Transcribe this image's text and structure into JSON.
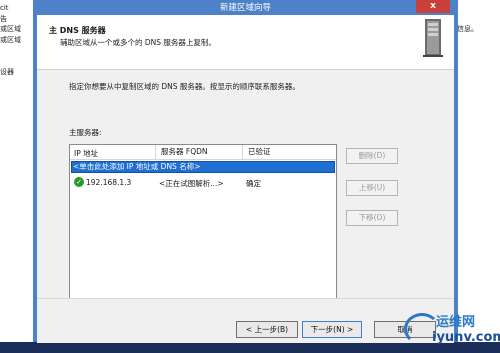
{
  "background": {
    "left_items": [
      "cit",
      "告",
      "或区域",
      "或区域",
      "设器"
    ],
    "right_text": "信息。"
  },
  "dialog": {
    "title": "新建区域向导",
    "close_label": "x",
    "header": {
      "title": "主 DNS 服务器",
      "subtitle": "辅助区域从一个或多个的 DNS 服务器上复制。"
    },
    "instruction": "指定你想要从中复制区域的 DNS 服务器。按显示的顺序联系服务器。",
    "table_label": "主服务器:",
    "columns": [
      "IP 地址",
      "服务器 FQDN",
      "已验证"
    ],
    "add_row_placeholder": "<单击此处添加 IP 地址或 DNS 名称>",
    "rows": [
      {
        "ip": "192.168.1.3",
        "fqdn": "<正在试图解析...>",
        "validated": "确定",
        "status_icon": "check-icon"
      }
    ],
    "side_buttons": {
      "delete": "删除(D)",
      "up": "上移(U)",
      "down": "下移(O)"
    },
    "footer_buttons": {
      "back": "< 上一步(B)",
      "next": "下一步(N) >",
      "cancel": "取消"
    }
  },
  "watermark": {
    "cn": "运维网",
    "en": "iyunv.com"
  },
  "colors": {
    "title_bar": "#4e82c8",
    "close": "#c7403a",
    "selection": "#1f6fd0",
    "ok": "#2a9a2a"
  }
}
